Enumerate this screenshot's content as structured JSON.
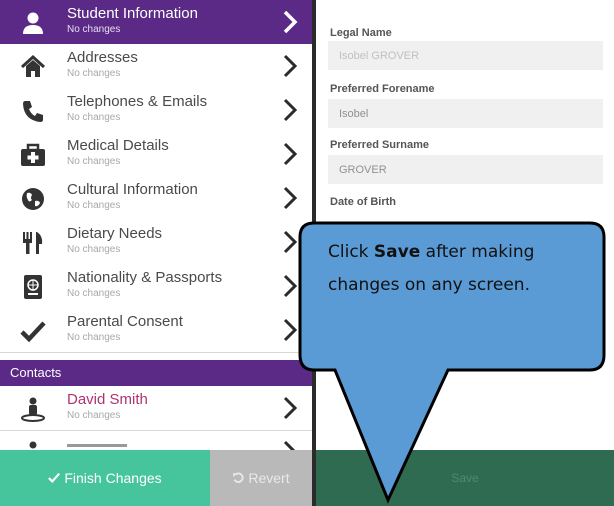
{
  "sidebar": {
    "items": [
      {
        "title": "Student Information",
        "status": "No changes",
        "icon": "person-icon"
      },
      {
        "title": "Addresses",
        "status": "No changes",
        "icon": "home-icon"
      },
      {
        "title": "Telephones & Emails",
        "status": "No changes",
        "icon": "phone-icon"
      },
      {
        "title": "Medical Details",
        "status": "No changes",
        "icon": "medical-kit-icon"
      },
      {
        "title": "Cultural Information",
        "status": "No changes",
        "icon": "globe-icon"
      },
      {
        "title": "Dietary Needs",
        "status": "No changes",
        "icon": "cutlery-icon"
      },
      {
        "title": "Nationality & Passports",
        "status": "No changes",
        "icon": "passport-icon"
      },
      {
        "title": "Parental Consent",
        "status": "No changes",
        "icon": "check-icon"
      }
    ],
    "contacts_header": "Contacts",
    "contacts": [
      {
        "title": "David Smith",
        "status": "No changes",
        "icon": "contact-person-icon"
      }
    ],
    "finish_label": "Finish Changes",
    "revert_label": "Revert"
  },
  "form": {
    "legal_name_label": "Legal Name",
    "legal_name_value": "Isobel GROVER",
    "preferred_forename_label": "Preferred Forename",
    "preferred_forename_value": "Isobel",
    "preferred_surname_label": "Preferred Surname",
    "preferred_surname_value": "GROVER",
    "dob_label": "Date of Birth",
    "save_label": "Save"
  },
  "callout": {
    "text_before": "Click ",
    "text_bold": "Save",
    "text_after": " after making changes on any screen."
  },
  "colors": {
    "brand_purple": "#5b2a86",
    "finish_green": "#46c49b",
    "save_green": "#2f6b50",
    "callout_blue": "#5b9bd5",
    "contact_pink": "#b0336e"
  }
}
